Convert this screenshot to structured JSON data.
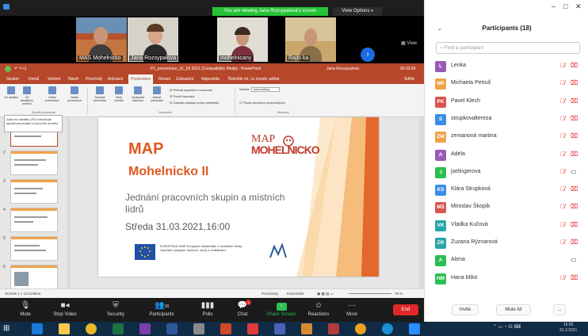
{
  "banner": {
    "viewing": "You are viewing Jana Rozsypalová's screen",
    "view_options": "View Options"
  },
  "thumbnails": [
    {
      "name": "MAS Mohelnicko"
    },
    {
      "name": "Jana Rozsypalová"
    },
    {
      "name": "mohelnicany"
    },
    {
      "name": "Rajbi ka"
    }
  ],
  "view_label": "View",
  "powerpoint": {
    "title": "P1_prezentace_31_03 2021 [Compatibility Mode] - PowerPoint",
    "user": "Jana Rozsypalová",
    "time": "00:32:54",
    "tabs": [
      "Soubor",
      "Domů",
      "Vložení",
      "Návrh",
      "Přechody",
      "Animace",
      "Prezentace",
      "Revize",
      "Zobrazení",
      "Nápověda",
      "Řekněte mi, co chcete udělat"
    ],
    "active_tab": "Prezentace",
    "share": "Sdílet",
    "ribbon": {
      "buttons": [
        "Od začátku",
        "Od aktuálního snímku",
        "Online prezentace",
        "Vlastní prezentace",
        "Nastavit prezentaci",
        "Skrýt snímek",
        "Vyzkoušet časování",
        "Nahrát prezentaci"
      ],
      "checks": [
        "Přehrát vyprávění a časování",
        "Použít časování",
        "Zobrazit ovládací prvky multimédií"
      ],
      "monitor_label": "Monitor:",
      "monitor_value": "Automaticky",
      "presenter_view": "Použít zobrazení prezentujícího",
      "groups": [
        "Spustit prezentaci",
        "Nastavení",
        "Monitory"
      ]
    },
    "tooltip": "Začít od začátku (F5) Umožňuje spustit prezentaci od prvního snímku.",
    "slide_numbers": [
      "1",
      "2",
      "3",
      "4",
      "5",
      "6"
    ],
    "slide": {
      "title1": "MAP",
      "title2": "Mohelnicko II",
      "subtitle": "Jednání pracovních skupin a místních lídrů",
      "date": "Středa 31.03.2021,16:00",
      "logo_top": "MAP",
      "logo_bottom": "MOHELNICKO",
      "eu_text": "EVROPSKÁ UNIE Evropské strukturální a investiční fondy Operační program Výzkum, vývoj a vzdělávání"
    },
    "status": {
      "left": "Snímek 1 z 13   Čeština",
      "notes": "Poznámky",
      "comments": "Komentáře",
      "zoom": "76 %"
    }
  },
  "toolbar": {
    "mute": "Mute",
    "stop_video": "Stop Video",
    "security": "Security",
    "participants": "Participants",
    "participants_count": "18",
    "polls": "Polls",
    "chat": "Chat",
    "chat_badge": "1",
    "share_screen": "Share Screen",
    "reactions": "Reactions",
    "more": "More",
    "end": "End"
  },
  "panel": {
    "title": "Participants (18)",
    "search_placeholder": "Find a participant",
    "participants": [
      {
        "initials": "L",
        "name": "Lenka",
        "color": "#9b59b6",
        "cam": "on"
      },
      {
        "initials": "MP",
        "name": "Michaela Petruš",
        "color": "#f0a24a",
        "cam": "on"
      },
      {
        "initials": "PK",
        "name": "Pavel Klech",
        "color": "#d9534f",
        "cam": "on"
      },
      {
        "initials": "S",
        "name": "strupkovaltereza",
        "color": "#3a8ee6",
        "cam": "on"
      },
      {
        "initials": "ZM",
        "name": "zemanová martina",
        "color": "#f0a24a",
        "cam": "on"
      },
      {
        "initials": "A",
        "name": "Adéla",
        "color": "#9b59b6",
        "cam": "on"
      },
      {
        "initials": "J",
        "name": "jselingerova",
        "color": "#2bbf52",
        "cam": "off"
      },
      {
        "initials": "KS",
        "name": "Klára Strupková",
        "color": "#3a8ee6",
        "cam": "on"
      },
      {
        "initials": "MŠ",
        "name": "Miroslav Škopík",
        "color": "#d9534f",
        "cam": "on"
      },
      {
        "initials": "VK",
        "name": "Vladka Kučová",
        "color": "#2aa5a5",
        "cam": "on"
      },
      {
        "initials": "ZR",
        "name": "Zuzana Rýznarová",
        "color": "#2aa5a5",
        "cam": "on"
      },
      {
        "initials": "A",
        "name": "Alena",
        "color": "#2bbf52",
        "cam": "off",
        "mic": "none"
      },
      {
        "initials": "HM",
        "name": "Hana Miko",
        "color": "#2bbf52",
        "cam": "on"
      }
    ],
    "invite": "Invite",
    "mute_all": "Mute All",
    "more": "..."
  },
  "taskbar": {
    "time": "16:06",
    "date": "31.3.2021"
  }
}
